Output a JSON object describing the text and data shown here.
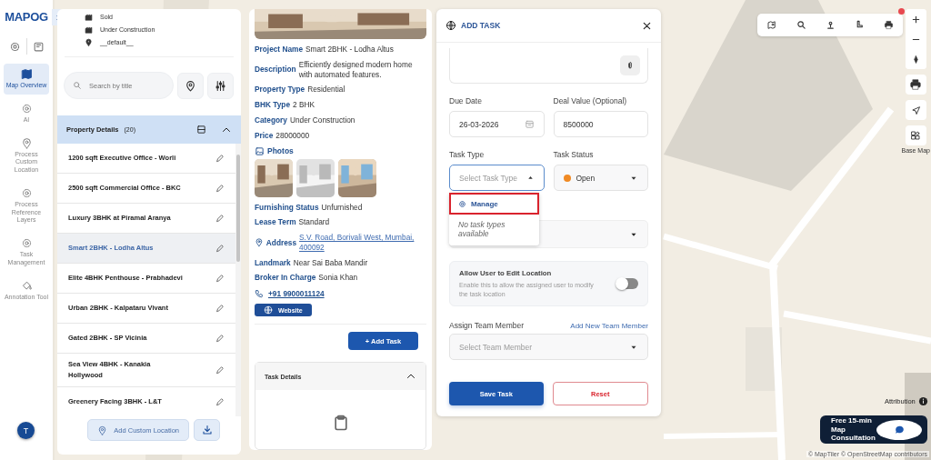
{
  "logo": "MAPOG",
  "nav": [
    {
      "label": "Map Overview",
      "selected": true
    },
    {
      "label": "AI",
      "selected": false
    },
    {
      "label": "Process Custom Location",
      "selected": false
    },
    {
      "label": "Process Reference Layers",
      "selected": false
    },
    {
      "label": "Task Management",
      "selected": false
    },
    {
      "label": "Annotation Tool",
      "selected": false
    }
  ],
  "avatar": "T",
  "legend": [
    {
      "kind": "building",
      "label": "Sold"
    },
    {
      "kind": "building",
      "label": "Under Construction"
    },
    {
      "kind": "pin",
      "label": "__default__"
    }
  ],
  "search": {
    "placeholder": "Search by title"
  },
  "property_list": {
    "title": "Property Details",
    "count": "(20)",
    "rows": [
      {
        "name": "1200 sqft Executive Office - Worli",
        "selected": false
      },
      {
        "name": "2500 sqft Commercial Office - BKC",
        "selected": false
      },
      {
        "name": "Luxury 3BHK at Piramal Aranya",
        "selected": false
      },
      {
        "name": "Smart 2BHK - Lodha Altus",
        "selected": true
      },
      {
        "name": "Elite 4BHK Penthouse - Prabhadevi",
        "selected": false
      },
      {
        "name": "Urban 2BHK - Kalpataru Vivant",
        "selected": false
      },
      {
        "name": "Gated 2BHK - SP Vicinia",
        "selected": false
      },
      {
        "name": "Sea View 4BHK - Kanakia Hollywood",
        "selected": false
      },
      {
        "name": "Greenery Facing 3BHK - L&T",
        "selected": false
      }
    ]
  },
  "add_location": "Add Custom Location",
  "details": [
    {
      "kind": "cover"
    },
    {
      "kind": "field",
      "label": "Project Name",
      "value": "Smart 2BHK - Lodha Altus"
    },
    {
      "kind": "field",
      "label": "Description",
      "value": "Efficiently designed modern home with automated features."
    },
    {
      "kind": "field",
      "label": "Property Type",
      "value": "Residential"
    },
    {
      "kind": "field",
      "label": "BHK Type",
      "value": "2 BHK"
    },
    {
      "kind": "field",
      "label": "Category",
      "value": "Under Construction"
    },
    {
      "kind": "field",
      "label": "Price",
      "value": "28000000"
    },
    {
      "kind": "heading",
      "label": "Photos"
    },
    {
      "kind": "photos"
    },
    {
      "kind": "field",
      "label": "Furnishing Status",
      "value": "Unfurnished"
    },
    {
      "kind": "field",
      "label": "Lease Term",
      "value": "Standard"
    },
    {
      "kind": "address",
      "label": "Address",
      "value": "S.V. Road, Borivali West, Mumbai, 400092"
    },
    {
      "kind": "field",
      "label": "Landmark",
      "value": "Near Sai Baba Mandir"
    },
    {
      "kind": "field",
      "label": "Broker In Charge",
      "value": "Sonia Khan"
    },
    {
      "kind": "phone",
      "value": "+91 9900011124"
    },
    {
      "kind": "website",
      "label": "Website"
    }
  ],
  "add_task_button": "+ Add Task",
  "task_details": {
    "title": "Task Details"
  },
  "task_form": {
    "title": "ADD TASK",
    "due_date": {
      "label": "Due Date",
      "value": "26-03-2026"
    },
    "deal_value": {
      "label": "Deal Value (Optional)",
      "value": "8500000"
    },
    "task_type": {
      "label": "Task Type",
      "placeholder": "Select Task Type",
      "expanded": true,
      "manage": "Manage",
      "empty": "No task types available"
    },
    "task_status": {
      "label": "Task Status",
      "value": "Open"
    },
    "allow_edit": {
      "title": "Allow User to Edit Location",
      "description": "Enable this to allow the assigned user to modify the task location",
      "on": false
    },
    "assign": {
      "label": "Assign Team Member",
      "link": "Add New Team Member",
      "placeholder": "Select Team Member"
    },
    "save": "Save Task",
    "reset": "Reset"
  },
  "base_map_label": "Base Map",
  "attribution": "Attribution",
  "consultation": "Free 15-min Map Consultation",
  "copyright": "© MapTiler © OpenStreetMap contributors"
}
